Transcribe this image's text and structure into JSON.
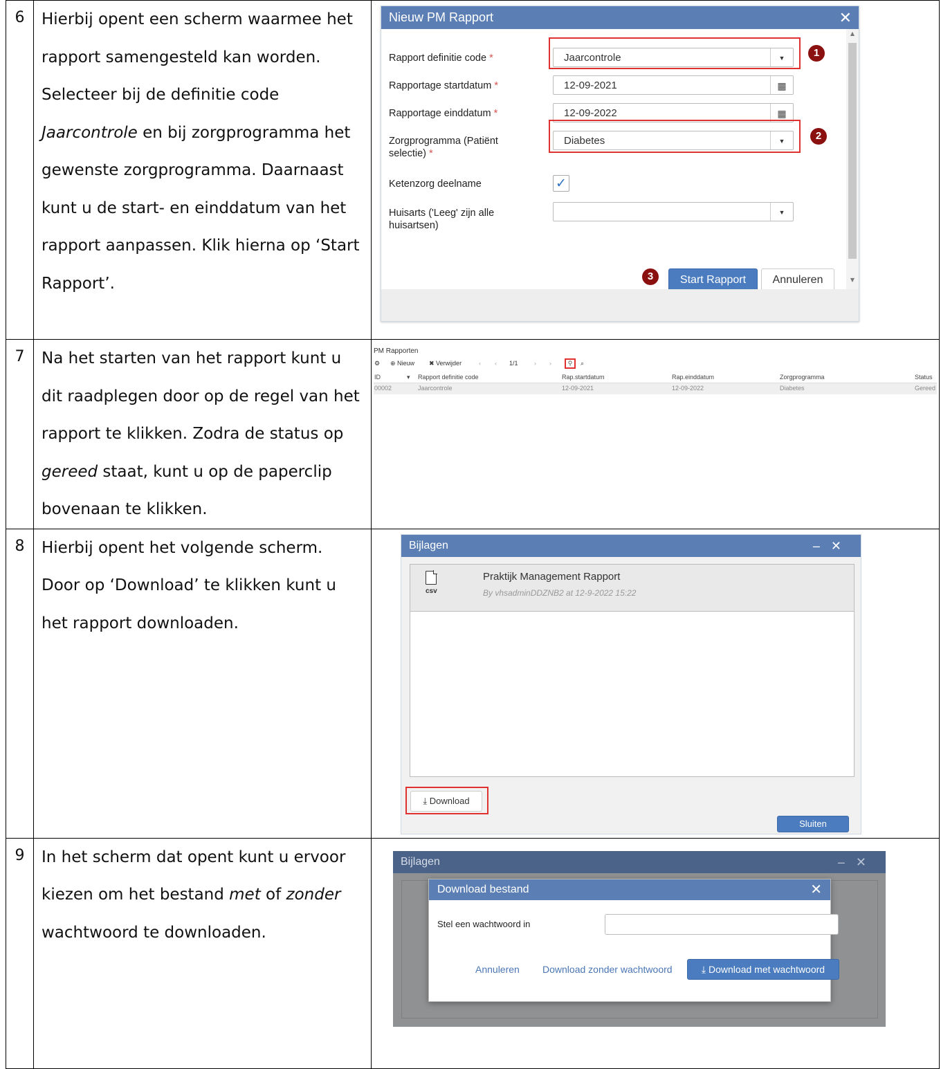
{
  "steps": [
    {
      "number": "6",
      "text_parts": [
        "Hierbij opent een scherm waarmee het rapport samengesteld kan worden. Selecteer bij de definitie code ",
        "Jaarcontrole",
        " en bij zorgprogramma het gewenste zorgprogramma. Daarnaast kunt u de start- en einddatum van het rapport aanpassen. Klik hierna op ‘Start Rapport’."
      ]
    },
    {
      "number": "7",
      "text_parts": [
        "Na het starten van het rapport kunt u dit raadplegen door op de regel van het rapport te klikken. Zodra de status op ",
        "gereed",
        " staat, kunt u op de paperclip bovenaan te klikken."
      ]
    },
    {
      "number": "8",
      "text_parts": [
        "Hierbij opent het volgende scherm. Door op ‘Download’ te klikken kunt u het rapport downloaden."
      ]
    },
    {
      "number": "9",
      "text_parts": [
        "In het scherm dat opent kunt u ervoor kiezen om het bestand ",
        "met",
        " of ",
        "zonder",
        " wachtwoord te downloaden."
      ]
    }
  ],
  "pm_dialog": {
    "title": "Nieuw PM Rapport",
    "required_mark": "*",
    "fields": {
      "definition_label": "Rapport definitie code",
      "definition_value": "Jaarcontrole",
      "start_label": "Rapportage startdatum",
      "start_value": "12-09-2021",
      "end_label": "Rapportage einddatum",
      "end_value": "12-09-2022",
      "program_label_1": "Zorgprogramma (Patiënt",
      "program_label_2": "selectie)",
      "program_value": "Diabetes",
      "chain_label": "Ketenzorg deelname",
      "chain_checked": true,
      "gp_label_1": "Huisarts ('Leeg' zijn alle",
      "gp_label_2": "huisartsen)",
      "gp_value": ""
    },
    "markers": [
      "1",
      "2",
      "3"
    ],
    "start_button": "Start Rapport",
    "cancel_button": "Annuleren"
  },
  "pm_list": {
    "title": "PM Rapporten",
    "toolbar": {
      "new": "Nieuw",
      "delete": "Verwijder",
      "paging": "1/1"
    },
    "columns": [
      "ID",
      "Rapport definitie code",
      "Rap.startdatum",
      "Rap.einddatum",
      "Zorgprogramma",
      "Status"
    ],
    "rows": [
      [
        "00002",
        "Jaarcontrole",
        "12-09-2021",
        "12-09-2022",
        "Diabetes",
        "Gereed"
      ]
    ]
  },
  "attachments_dialog": {
    "title": "Bijlagen",
    "file_type": "csv",
    "file_title": "Praktijk Management Rapport",
    "file_meta": "By vhsadminDDZNB2 at 12-9-2022 15:22",
    "download_button": "Download",
    "close_button": "Sluiten"
  },
  "download_dialog": {
    "background_title": "Bijlagen",
    "title": "Download bestand",
    "password_label": "Stel een wachtwoord in",
    "password_value": "",
    "cancel_link": "Annuleren",
    "without_password": "Download zonder wachtwoord",
    "with_password": "Download met wachtwoord"
  },
  "colors": {
    "titlebar": "#5b7fb4",
    "primary_button": "#4a7cbf",
    "highlight_box": "#e03030",
    "marker": "#8b1010",
    "link": "#4a76b5"
  }
}
